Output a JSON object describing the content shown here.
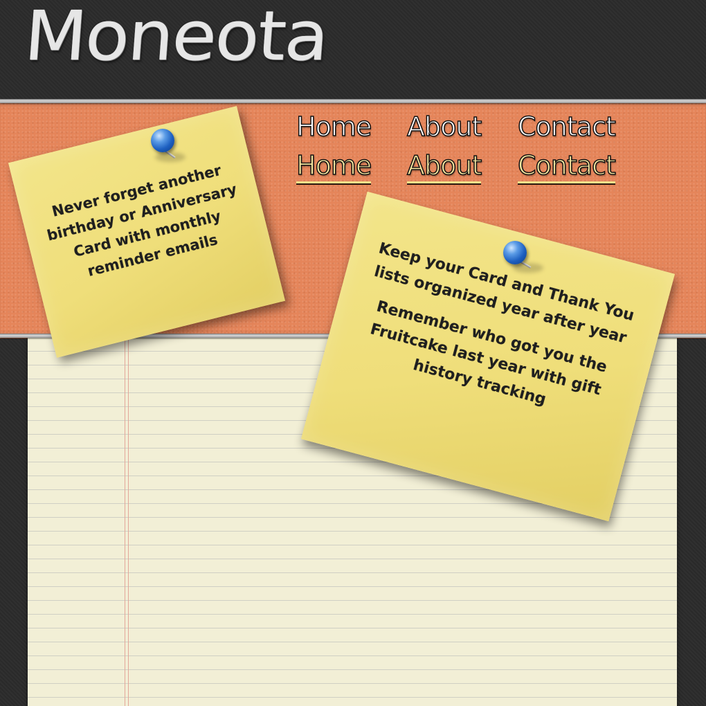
{
  "header": {
    "logo_text": "Moneota"
  },
  "nav": {
    "items": [
      {
        "label": "Home"
      },
      {
        "label": "About"
      },
      {
        "label": "Contact"
      }
    ],
    "active_items": [
      {
        "label": "Home"
      },
      {
        "label": "About"
      },
      {
        "label": "Contact"
      }
    ]
  },
  "notes": [
    {
      "lines": [
        "Never forget another",
        "birthday or Anniversary",
        "Card with monthly",
        "reminder emails"
      ]
    },
    {
      "paragraph1": [
        "Keep your Card and Thank You",
        "lists organized year after year"
      ],
      "paragraph2": [
        "Remember who got you the",
        "Fruitcake last year with gift",
        "history tracking"
      ]
    }
  ],
  "colors": {
    "background": "#2b2b2b",
    "band": "#e5855a",
    "paper": "#f2efd6",
    "note": "#efde7a",
    "pin": "#1d5fc0",
    "nav_active": "#f7e7a0"
  },
  "icons": {
    "pin_1": "push-pin-icon",
    "pin_2": "push-pin-icon"
  }
}
